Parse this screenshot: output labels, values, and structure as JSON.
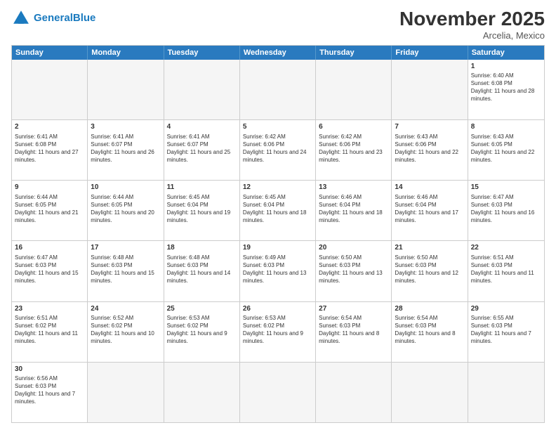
{
  "header": {
    "logo_general": "General",
    "logo_blue": "Blue",
    "month_title": "November 2025",
    "location": "Arcelia, Mexico"
  },
  "days": [
    "Sunday",
    "Monday",
    "Tuesday",
    "Wednesday",
    "Thursday",
    "Friday",
    "Saturday"
  ],
  "rows": [
    [
      {
        "date": "",
        "empty": true
      },
      {
        "date": "",
        "empty": true
      },
      {
        "date": "",
        "empty": true
      },
      {
        "date": "",
        "empty": true
      },
      {
        "date": "",
        "empty": true
      },
      {
        "date": "",
        "empty": true
      },
      {
        "date": "1",
        "sunrise": "Sunrise: 6:40 AM",
        "sunset": "Sunset: 6:08 PM",
        "daylight": "Daylight: 11 hours and 28 minutes."
      }
    ],
    [
      {
        "date": "2",
        "sunrise": "Sunrise: 6:41 AM",
        "sunset": "Sunset: 6:08 PM",
        "daylight": "Daylight: 11 hours and 27 minutes."
      },
      {
        "date": "3",
        "sunrise": "Sunrise: 6:41 AM",
        "sunset": "Sunset: 6:07 PM",
        "daylight": "Daylight: 11 hours and 26 minutes."
      },
      {
        "date": "4",
        "sunrise": "Sunrise: 6:41 AM",
        "sunset": "Sunset: 6:07 PM",
        "daylight": "Daylight: 11 hours and 25 minutes."
      },
      {
        "date": "5",
        "sunrise": "Sunrise: 6:42 AM",
        "sunset": "Sunset: 6:06 PM",
        "daylight": "Daylight: 11 hours and 24 minutes."
      },
      {
        "date": "6",
        "sunrise": "Sunrise: 6:42 AM",
        "sunset": "Sunset: 6:06 PM",
        "daylight": "Daylight: 11 hours and 23 minutes."
      },
      {
        "date": "7",
        "sunrise": "Sunrise: 6:43 AM",
        "sunset": "Sunset: 6:06 PM",
        "daylight": "Daylight: 11 hours and 22 minutes."
      },
      {
        "date": "8",
        "sunrise": "Sunrise: 6:43 AM",
        "sunset": "Sunset: 6:05 PM",
        "daylight": "Daylight: 11 hours and 22 minutes."
      }
    ],
    [
      {
        "date": "9",
        "sunrise": "Sunrise: 6:44 AM",
        "sunset": "Sunset: 6:05 PM",
        "daylight": "Daylight: 11 hours and 21 minutes."
      },
      {
        "date": "10",
        "sunrise": "Sunrise: 6:44 AM",
        "sunset": "Sunset: 6:05 PM",
        "daylight": "Daylight: 11 hours and 20 minutes."
      },
      {
        "date": "11",
        "sunrise": "Sunrise: 6:45 AM",
        "sunset": "Sunset: 6:04 PM",
        "daylight": "Daylight: 11 hours and 19 minutes."
      },
      {
        "date": "12",
        "sunrise": "Sunrise: 6:45 AM",
        "sunset": "Sunset: 6:04 PM",
        "daylight": "Daylight: 11 hours and 18 minutes."
      },
      {
        "date": "13",
        "sunrise": "Sunrise: 6:46 AM",
        "sunset": "Sunset: 6:04 PM",
        "daylight": "Daylight: 11 hours and 18 minutes."
      },
      {
        "date": "14",
        "sunrise": "Sunrise: 6:46 AM",
        "sunset": "Sunset: 6:04 PM",
        "daylight": "Daylight: 11 hours and 17 minutes."
      },
      {
        "date": "15",
        "sunrise": "Sunrise: 6:47 AM",
        "sunset": "Sunset: 6:03 PM",
        "daylight": "Daylight: 11 hours and 16 minutes."
      }
    ],
    [
      {
        "date": "16",
        "sunrise": "Sunrise: 6:47 AM",
        "sunset": "Sunset: 6:03 PM",
        "daylight": "Daylight: 11 hours and 15 minutes."
      },
      {
        "date": "17",
        "sunrise": "Sunrise: 6:48 AM",
        "sunset": "Sunset: 6:03 PM",
        "daylight": "Daylight: 11 hours and 15 minutes."
      },
      {
        "date": "18",
        "sunrise": "Sunrise: 6:48 AM",
        "sunset": "Sunset: 6:03 PM",
        "daylight": "Daylight: 11 hours and 14 minutes."
      },
      {
        "date": "19",
        "sunrise": "Sunrise: 6:49 AM",
        "sunset": "Sunset: 6:03 PM",
        "daylight": "Daylight: 11 hours and 13 minutes."
      },
      {
        "date": "20",
        "sunrise": "Sunrise: 6:50 AM",
        "sunset": "Sunset: 6:03 PM",
        "daylight": "Daylight: 11 hours and 13 minutes."
      },
      {
        "date": "21",
        "sunrise": "Sunrise: 6:50 AM",
        "sunset": "Sunset: 6:03 PM",
        "daylight": "Daylight: 11 hours and 12 minutes."
      },
      {
        "date": "22",
        "sunrise": "Sunrise: 6:51 AM",
        "sunset": "Sunset: 6:03 PM",
        "daylight": "Daylight: 11 hours and 11 minutes."
      }
    ],
    [
      {
        "date": "23",
        "sunrise": "Sunrise: 6:51 AM",
        "sunset": "Sunset: 6:02 PM",
        "daylight": "Daylight: 11 hours and 11 minutes."
      },
      {
        "date": "24",
        "sunrise": "Sunrise: 6:52 AM",
        "sunset": "Sunset: 6:02 PM",
        "daylight": "Daylight: 11 hours and 10 minutes."
      },
      {
        "date": "25",
        "sunrise": "Sunrise: 6:53 AM",
        "sunset": "Sunset: 6:02 PM",
        "daylight": "Daylight: 11 hours and 9 minutes."
      },
      {
        "date": "26",
        "sunrise": "Sunrise: 6:53 AM",
        "sunset": "Sunset: 6:02 PM",
        "daylight": "Daylight: 11 hours and 9 minutes."
      },
      {
        "date": "27",
        "sunrise": "Sunrise: 6:54 AM",
        "sunset": "Sunset: 6:03 PM",
        "daylight": "Daylight: 11 hours and 8 minutes."
      },
      {
        "date": "28",
        "sunrise": "Sunrise: 6:54 AM",
        "sunset": "Sunset: 6:03 PM",
        "daylight": "Daylight: 11 hours and 8 minutes."
      },
      {
        "date": "29",
        "sunrise": "Sunrise: 6:55 AM",
        "sunset": "Sunset: 6:03 PM",
        "daylight": "Daylight: 11 hours and 7 minutes."
      }
    ],
    [
      {
        "date": "30",
        "sunrise": "Sunrise: 6:56 AM",
        "sunset": "Sunset: 6:03 PM",
        "daylight": "Daylight: 11 hours and 7 minutes."
      },
      {
        "date": "",
        "empty": true
      },
      {
        "date": "",
        "empty": true
      },
      {
        "date": "",
        "empty": true
      },
      {
        "date": "",
        "empty": true
      },
      {
        "date": "",
        "empty": true
      },
      {
        "date": "",
        "empty": true
      }
    ]
  ]
}
